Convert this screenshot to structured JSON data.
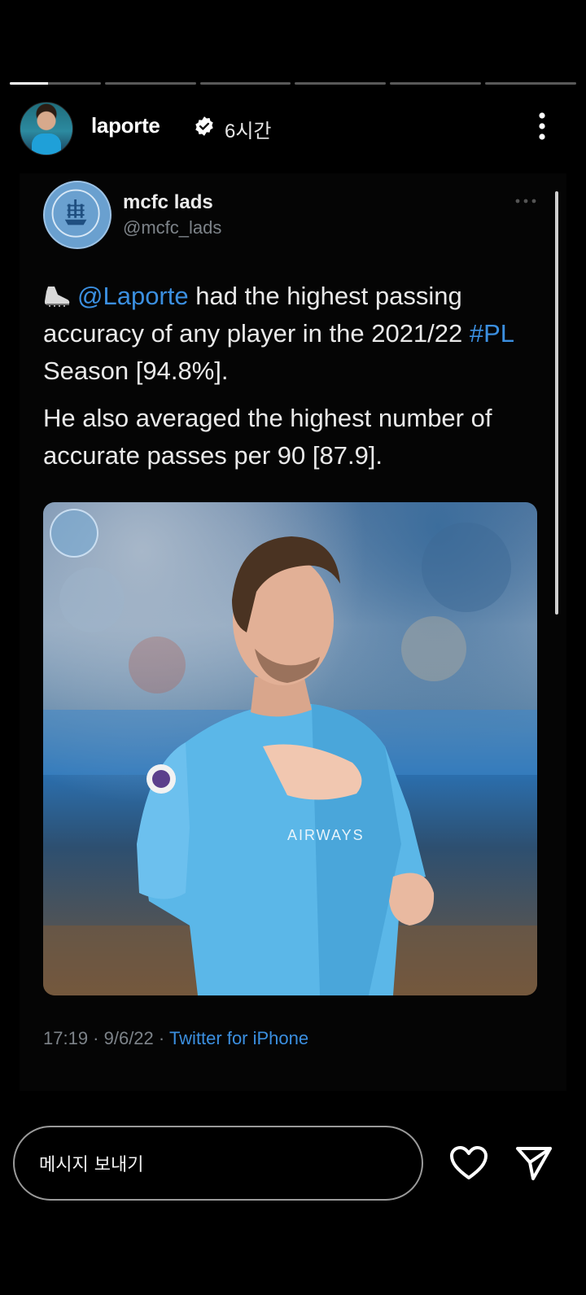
{
  "story": {
    "progress_segments": [
      {
        "fill": 0.42
      },
      {
        "fill": 0
      },
      {
        "fill": 0
      },
      {
        "fill": 0
      },
      {
        "fill": 0
      },
      {
        "fill": 0
      }
    ],
    "username": "laporte",
    "time": "6시간",
    "verified_icon": "verified-badge-icon",
    "more_icon": "more-vertical-icon"
  },
  "tweet": {
    "name": "mcfc lads",
    "handle": "@mcfc_lads",
    "more_icon": "more-horizontal-icon",
    "text_p1_icon": "football-boot-icon",
    "text_p1_mention": "@Laporte",
    "text_p1_part1": " had the highest passing accuracy of any player in the 2021/22 ",
    "text_p1_hashtag": "#PL",
    "text_p1_part2": " Season [94.8%].",
    "text_p2": "He also averaged the highest number of accurate passes per 90 [87.9].",
    "photo_alt": "player-photo",
    "timestamp": "17:19 · 9/6/22 · ",
    "source": "Twitter for iPhone"
  },
  "bottom": {
    "message_placeholder": "메시지 보내기",
    "heart_icon": "heart-icon",
    "send_icon": "send-icon"
  },
  "colors": {
    "link": "#3b8fe0",
    "background": "#000000",
    "muted": "#7d8389"
  }
}
